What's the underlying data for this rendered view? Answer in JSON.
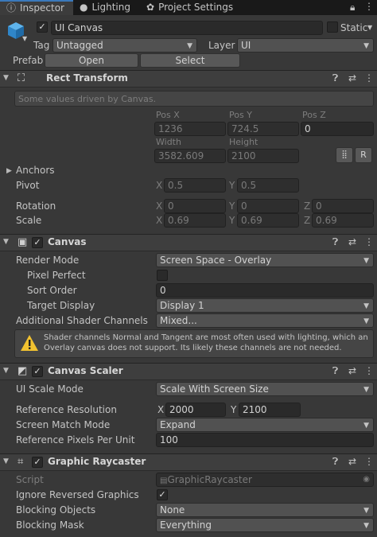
{
  "tabs": [
    {
      "label": "Inspector",
      "icon": "info-icon",
      "active": true
    },
    {
      "label": "Lighting",
      "icon": "bulb-icon",
      "active": false
    },
    {
      "label": "Project Settings",
      "icon": "gear-icon",
      "active": false
    }
  ],
  "object": {
    "name": "UI Canvas",
    "active": true,
    "static_label": "Static",
    "tag_label": "Tag",
    "tag_value": "Untagged",
    "layer_label": "Layer",
    "layer_value": "UI",
    "prefab_label": "Prefab",
    "open_label": "Open",
    "select_label": "Select"
  },
  "rect_transform": {
    "title": "Rect Transform",
    "note": "Some values driven by Canvas.",
    "pos_x_label": "Pos X",
    "pos_y_label": "Pos Y",
    "pos_z_label": "Pos Z",
    "pos_x": "1236",
    "pos_y": "724.5",
    "pos_z": "0",
    "width_label": "Width",
    "height_label": "Height",
    "width": "3582.609",
    "height": "2100",
    "r_button": "R",
    "anchors_label": "Anchors",
    "pivot_label": "Pivot",
    "pivot_x": "0.5",
    "pivot_y": "0.5",
    "rotation_label": "Rotation",
    "rot_x": "0",
    "rot_y": "0",
    "rot_z": "0",
    "scale_label": "Scale",
    "scale_x": "0.69",
    "scale_y": "0.69",
    "scale_z": "0.69",
    "axis_x": "X",
    "axis_y": "Y",
    "axis_z": "Z"
  },
  "canvas": {
    "title": "Canvas",
    "enabled": true,
    "render_mode_label": "Render Mode",
    "render_mode": "Screen Space - Overlay",
    "pixel_perfect_label": "Pixel Perfect",
    "sort_order_label": "Sort Order",
    "sort_order": "0",
    "target_display_label": "Target Display",
    "target_display": "Display 1",
    "shader_channels_label": "Additional Shader Channels",
    "shader_channels": "Mixed...",
    "warning": "Shader channels Normal and Tangent are most often used with lighting, which an Overlay canvas does not support. Its likely these channels are not needed."
  },
  "canvas_scaler": {
    "title": "Canvas Scaler",
    "enabled": true,
    "ui_scale_mode_label": "UI Scale Mode",
    "ui_scale_mode": "Scale With Screen Size",
    "ref_res_label": "Reference Resolution",
    "ref_x": "2000",
    "ref_y": "2100",
    "match_mode_label": "Screen Match Mode",
    "match_mode": "Expand",
    "ref_ppu_label": "Reference Pixels Per Unit",
    "ref_ppu": "100"
  },
  "graphic_raycaster": {
    "title": "Graphic Raycaster",
    "enabled": true,
    "script_label": "Script",
    "script_value": "GraphicRaycaster",
    "ignore_reversed_label": "Ignore Reversed Graphics",
    "blocking_objects_label": "Blocking Objects",
    "blocking_objects": "None",
    "blocking_mask_label": "Blocking Mask",
    "blocking_mask": "Everything"
  },
  "colors": {
    "panel_bg": "#383838",
    "tab_accent": "#3a79bb",
    "warning_yellow": "#f2c230"
  }
}
